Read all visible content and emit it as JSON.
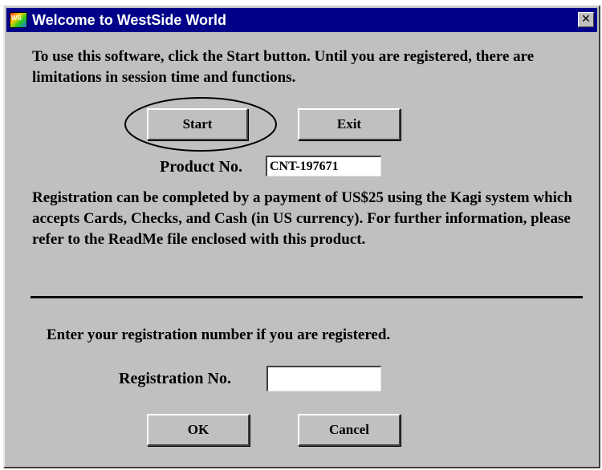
{
  "window": {
    "title": "Welcome to WestSide World",
    "icon": "westside-app-icon",
    "icon_text": "WS",
    "close_glyph": "✕"
  },
  "intro_text": "To use this software, click the Start button. Until you are registered, there are limitations in session time and functions.",
  "buttons": {
    "start_label": "Start",
    "exit_label": "Exit",
    "ok_label": "OK",
    "cancel_label": "Cancel"
  },
  "product": {
    "label": "Product No.",
    "value": "CNT-197671"
  },
  "registration_info": "Registration can be completed by a payment of US$25 using the Kagi system which accepts Cards, Checks, and Cash (in US currency). For further information, please refer to the ReadMe file enclosed with this product.",
  "registration": {
    "prompt": "Enter your registration number if you are registered.",
    "label": "Registration No.",
    "value": ""
  },
  "colors": {
    "titlebar": "#000088",
    "window_background": "#c0c0c0",
    "field_background": "#ffffff"
  }
}
